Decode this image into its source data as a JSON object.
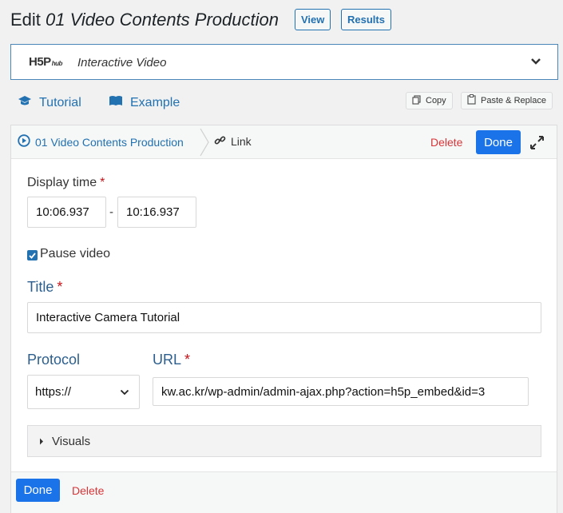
{
  "header": {
    "edit_prefix": "Edit",
    "content_title": "01 Video Contents Production",
    "view_label": "View",
    "results_label": "Results"
  },
  "library": {
    "logo_text": "H5P",
    "logo_sub": "hub",
    "name": "Interactive Video"
  },
  "help": {
    "tutorial_label": "Tutorial",
    "example_label": "Example",
    "copy_label": "Copy",
    "paste_label": "Paste & Replace"
  },
  "breadcrumb": {
    "parent": "01 Video Contents Production",
    "current": "Link",
    "delete_label": "Delete",
    "done_label": "Done"
  },
  "form": {
    "display_time_label": "Display time",
    "start_time": "10:06.937",
    "time_separator": "-",
    "end_time": "10:16.937",
    "pause_video_label": "Pause video",
    "pause_video_checked": true,
    "title_label": "Title",
    "title_value": "Interactive Camera Tutorial",
    "protocol_label": "Protocol",
    "protocol_value": "https://",
    "url_label": "URL",
    "url_value": "kw.ac.kr/wp-admin/admin-ajax.php?action=h5p_embed&id=3",
    "visuals_label": "Visuals",
    "required_mark": "*"
  },
  "footer": {
    "done_label": "Done",
    "delete_label": "Delete"
  },
  "colors": {
    "accent": "#2271b1",
    "done_button": "#1a73e8",
    "delete": "#d63638",
    "required": "#c4141a",
    "label_blue": "#2c5f8d"
  }
}
